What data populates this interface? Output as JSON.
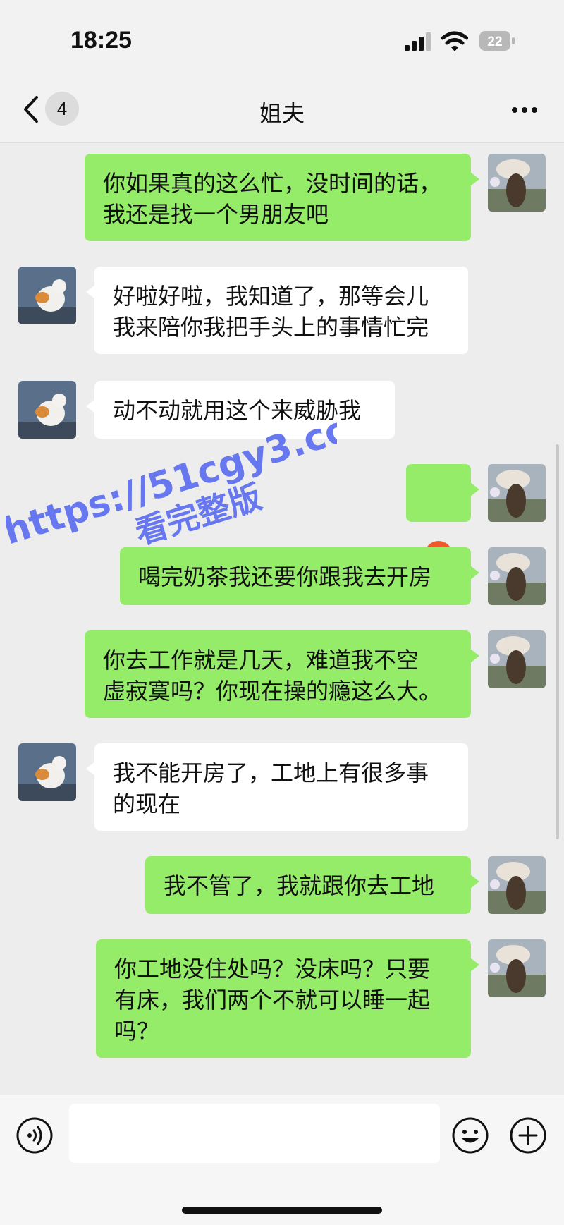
{
  "status": {
    "time": "18:25",
    "battery": "22"
  },
  "nav": {
    "unread_count": "4",
    "title": "姐夫"
  },
  "messages": [
    {
      "from": "me",
      "text": "你如果真的这么忙，没时间的话，\n我还是找一个男朋友吧"
    },
    {
      "from": "other",
      "text": "好啦好啦，我知道了，那等会儿\n我来陪你我把手头上的事情忙完"
    },
    {
      "from": "other",
      "text": "动不动就用这个来威胁我"
    },
    {
      "from": "me",
      "emoji": "angry-face"
    },
    {
      "from": "me",
      "text": "喝完奶茶我还要你跟我去开房"
    },
    {
      "from": "me",
      "text": "你去工作就是几天，难道我不空\n虚寂寞吗？你现在操的瘾这么大。"
    },
    {
      "from": "other",
      "text": "我不能开房了，工地上有很多事\n的现在"
    },
    {
      "from": "me",
      "text": "我不管了，我就跟你去工地"
    },
    {
      "from": "me",
      "text": "你工地没住处吗？没床吗？只要\n有床，我们两个不就可以睡一起\n吗？"
    }
  ],
  "watermark": {
    "line1": "https://51cgy3.com",
    "line2": "看完整版"
  },
  "colors": {
    "my_bubble": "#95ec69",
    "other_bubble": "#ffffff",
    "background": "#ededed",
    "watermark": "#5b6cf0"
  }
}
